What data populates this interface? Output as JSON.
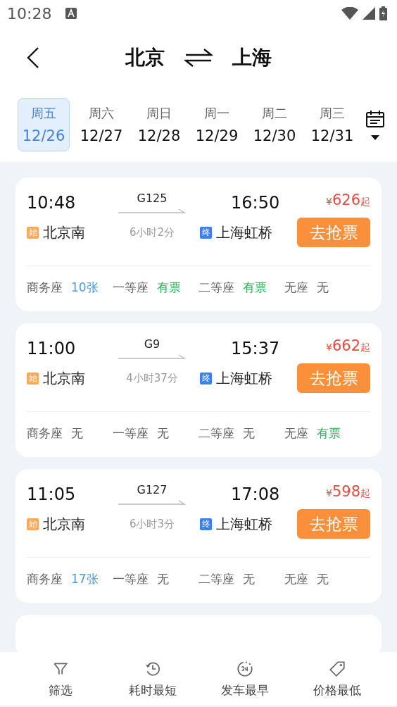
{
  "status_bar": {
    "time": "10:28"
  },
  "header": {
    "from": "北京",
    "to": "上海"
  },
  "dates": [
    {
      "weekday": "周五",
      "date": "12/26",
      "selected": true
    },
    {
      "weekday": "周六",
      "date": "12/27",
      "selected": false
    },
    {
      "weekday": "周日",
      "date": "12/28",
      "selected": false
    },
    {
      "weekday": "周一",
      "date": "12/29",
      "selected": false
    },
    {
      "weekday": "周二",
      "date": "12/30",
      "selected": false
    },
    {
      "weekday": "周三",
      "date": "12/31",
      "selected": false
    }
  ],
  "trains": [
    {
      "depart": "10:48",
      "number": "G125",
      "arrive": "16:50",
      "price_symbol": "¥",
      "price": "626",
      "price_suffix": "起",
      "from_badge": "始",
      "from_station": "北京南",
      "duration": "6小时2分",
      "to_badge": "终",
      "to_station": "上海虹桥",
      "action": "去抢票",
      "seats": [
        {
          "name": "商务座",
          "status": "10张",
          "kind": "count"
        },
        {
          "name": "一等座",
          "status": "有票",
          "kind": "available"
        },
        {
          "name": "二等座",
          "status": "有票",
          "kind": "available"
        },
        {
          "name": "无座",
          "status": "无",
          "kind": "none"
        }
      ]
    },
    {
      "depart": "11:00",
      "number": "G9",
      "arrive": "15:37",
      "price_symbol": "¥",
      "price": "662",
      "price_suffix": "起",
      "from_badge": "始",
      "from_station": "北京南",
      "duration": "4小时37分",
      "to_badge": "终",
      "to_station": "上海虹桥",
      "action": "去抢票",
      "seats": [
        {
          "name": "商务座",
          "status": "无",
          "kind": "none"
        },
        {
          "name": "一等座",
          "status": "无",
          "kind": "none"
        },
        {
          "name": "二等座",
          "status": "无",
          "kind": "none"
        },
        {
          "name": "无座",
          "status": "有票",
          "kind": "available"
        }
      ]
    },
    {
      "depart": "11:05",
      "number": "G127",
      "arrive": "17:08",
      "price_symbol": "¥",
      "price": "598",
      "price_suffix": "起",
      "from_badge": "始",
      "from_station": "北京南",
      "duration": "6小时3分",
      "to_badge": "终",
      "to_station": "上海虹桥",
      "action": "去抢票",
      "seats": [
        {
          "name": "商务座",
          "status": "17张",
          "kind": "count"
        },
        {
          "name": "一等座",
          "status": "无",
          "kind": "none"
        },
        {
          "name": "二等座",
          "status": "无",
          "kind": "none"
        },
        {
          "name": "无座",
          "status": "无",
          "kind": "none"
        }
      ]
    }
  ],
  "bottom_nav": [
    {
      "label": "筛选",
      "kind": "filter"
    },
    {
      "label": "耗时最短",
      "kind": "history"
    },
    {
      "label": "发车最早",
      "kind": "clock24"
    },
    {
      "label": "价格最低",
      "kind": "tag"
    }
  ]
}
